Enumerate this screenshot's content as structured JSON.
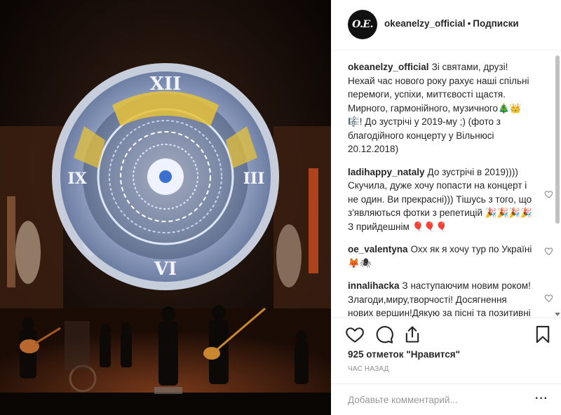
{
  "post": {
    "author_avatar_text": "O.E.",
    "author": "okeanelzy_official",
    "separator": "•",
    "follow_state": "Подписки"
  },
  "caption": {
    "user": "okeanelzy_official",
    "text": "Зі святами, друзі! Нехай час нового року рахує наші спільні перемоги, успіхи, миттєвості щастя. Мирного, гармонійного, музичного🎄👑🎼! До зустрічі у 2019-му ;) (фото з благодійного концерту у Вільнюсі 20.12.2018)"
  },
  "comments": [
    {
      "user": "ladihappy_nataly",
      "text": "До зустрічі в 2019)))) Скучила, дуже хочу попасти на концерт і не один. Ви прекрасні))) Тішусь з того, що з'являються фотки з репетицій 🎉🎉🎉🎉 З прийдешнім 🎈🎈🎈"
    },
    {
      "user": "oe_valentyna",
      "text": "Охх як я хочу тур по Україні🦊🕷"
    },
    {
      "user": "innalihacka",
      "text": "З наступаючим новим роком!Злагоди,миру,творчості! Досягнення нових вершин!Дякую за пісні та позитивні емоції!!!"
    }
  ],
  "stats": {
    "likes_text": "925 отметок \"Нравится\"",
    "time_ago": "час назад"
  },
  "add_comment": {
    "placeholder": "Добавьте комментарий..."
  },
  "icons": {
    "like": "heart-icon",
    "comment": "comment-icon",
    "share": "share-icon",
    "save": "bookmark-icon",
    "more": "more-options-icon"
  }
}
